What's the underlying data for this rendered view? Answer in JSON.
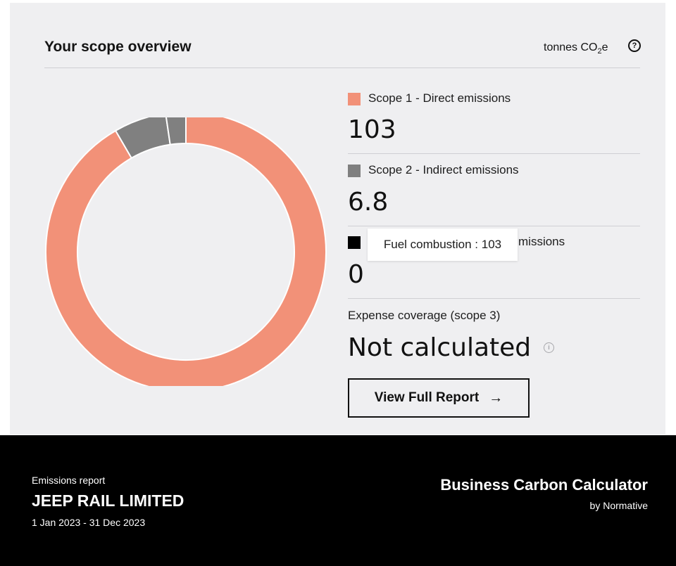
{
  "overview": {
    "title": "Your scope overview",
    "unit_prefix": "tonnes CO",
    "unit_sub": "2",
    "unit_suffix": "e",
    "help_icon": "question-circle-icon"
  },
  "chart_data": {
    "type": "pie",
    "donut": true,
    "categories": [
      "Scope 1 - Direct emissions",
      "Scope 2 - Indirect emissions",
      "Scope 3 - Indirect emissions"
    ],
    "values": [
      103,
      6.8,
      0
    ],
    "slice_values_visible_in_chart": [
      103,
      6.8,
      2.6
    ],
    "colors": [
      "#F29178",
      "#808080",
      "#808080"
    ]
  },
  "legend": [
    {
      "label": "Scope 1 - Direct emissions",
      "value": "103",
      "color": "#F29178"
    },
    {
      "label": "Scope 2 - Indirect emissions",
      "value": "6.8",
      "color": "#7f7f7f"
    },
    {
      "label": "missions",
      "value": "0",
      "color": "#000000"
    }
  ],
  "tooltip": {
    "text": "Fuel combustion : 103"
  },
  "expense": {
    "label": "Expense coverage (scope 3)",
    "value": "Not calculated",
    "info_icon": "info-icon"
  },
  "button": {
    "label": "View Full Report",
    "arrow": "→"
  },
  "footer": {
    "small": "Emissions report",
    "company": "JEEP RAIL LIMITED",
    "period": "1 Jan 2023 - 31 Dec 2023",
    "brand": "Business Carbon Calculator",
    "by": "by Normative"
  }
}
